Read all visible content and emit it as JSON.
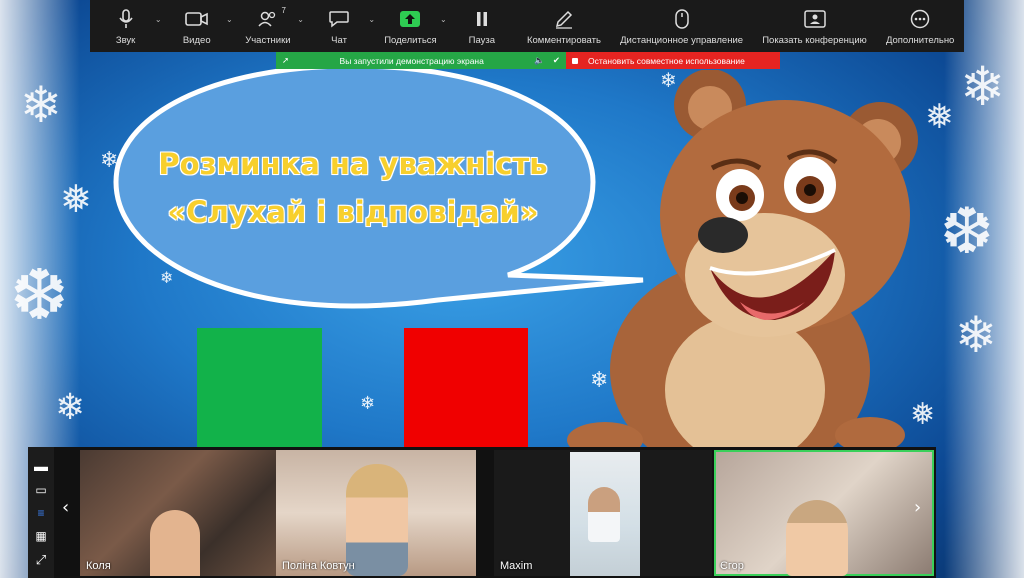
{
  "toolbar": {
    "items": [
      {
        "label": "Звук",
        "icon": "microphone-icon"
      },
      {
        "label": "Видео",
        "icon": "video-camera-icon"
      },
      {
        "label": "Участники",
        "icon": "participants-icon",
        "count": "7"
      },
      {
        "label": "Чат",
        "icon": "chat-icon"
      },
      {
        "label": "Поделиться",
        "icon": "share-screen-icon"
      },
      {
        "label": "Пауза",
        "icon": "pause-icon"
      },
      {
        "label": "Комментировать",
        "icon": "annotate-pen-icon"
      },
      {
        "label": "Дистанционное управление",
        "icon": "remote-control-mouse-icon"
      },
      {
        "label": "Показать конференцию",
        "icon": "show-meeting-icon"
      },
      {
        "label": "Дополнительно",
        "icon": "more-icon"
      }
    ]
  },
  "share_bar": {
    "status_text": "Вы запустили демонстрацию экрана",
    "stop_label": "Остановить совместное использование",
    "status_color": "#25a646",
    "stop_color": "#e52421"
  },
  "slide": {
    "title_line1": "Розминка на уважність",
    "title_line2": "«Слухай і відповідай»",
    "green_color": "#12b24a",
    "red_color": "#f00000"
  },
  "gallery": {
    "participants": [
      {
        "name": "Коля"
      },
      {
        "name": "Поліна Ковтун"
      },
      {
        "name": "Maxim"
      },
      {
        "name": "Єгор"
      }
    ]
  }
}
